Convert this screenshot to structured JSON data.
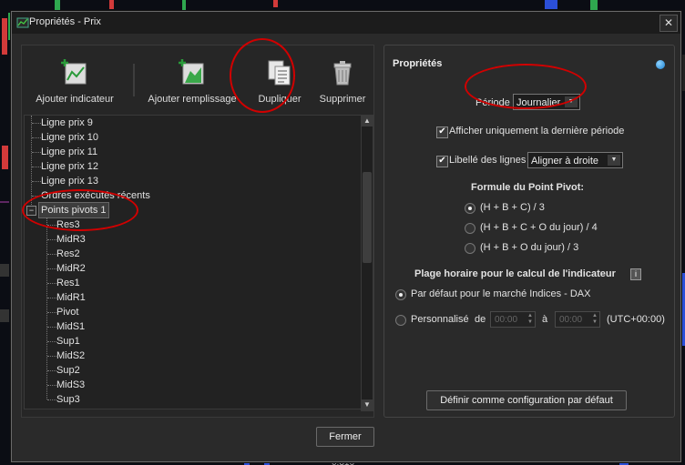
{
  "window": {
    "title": "Propriétés - Prix",
    "close_glyph": "✕"
  },
  "toolbar": {
    "add_indicator": "Ajouter indicateur",
    "add_fill": "Ajouter remplissage",
    "duplicate": "Dupliquer",
    "delete": "Supprimer"
  },
  "tree": {
    "items": [
      "Ligne prix 9",
      "Ligne prix 10",
      "Ligne prix 11",
      "Ligne prix 12",
      "Ligne prix 13",
      "Ordres exécutés récents",
      "Points pivots 1"
    ],
    "expander": "−",
    "children": [
      "Res3",
      "MidR3",
      "Res2",
      "MidR2",
      "Res1",
      "MidR1",
      "Pivot",
      "MidS1",
      "Sup1",
      "MidS2",
      "Sup2",
      "MidS3",
      "Sup3"
    ]
  },
  "properties": {
    "title": "Propriétés",
    "period_label": "Période",
    "period_value": "Journalier",
    "show_last_period_label": "Afficher uniquement la dernière période",
    "show_last_period_checked": true,
    "line_labels_label": "Libellé des lignes",
    "line_labels_checked": true,
    "line_labels_value": "Aligner à droite",
    "pivot_formula_title": "Formule du Point Pivot:",
    "formula_options": [
      "(H + B + C) / 3",
      "(H + B + C + O du jour) / 4",
      "(H + B + O du jour) / 3"
    ],
    "formula_selected": 0,
    "time_range_title": "Plage horaire pour le calcul de l'indicateur",
    "time_default_label": "Par défaut pour le marché Indices - DAX",
    "time_custom_label": "Personnalisé",
    "time_from_label": "de",
    "time_from_value": "00:00",
    "time_to_label": "à",
    "time_to_value": "00:00",
    "timezone": "(UTC+00:00)",
    "set_default_button": "Définir comme configuration par défaut"
  },
  "footer": {
    "close_button": "Fermer"
  },
  "background": {
    "partial_value": "0.316"
  },
  "colors": {
    "annotation_red": "#d10000",
    "dialog_bg": "#2a2a2a",
    "accent_blue": "#1a7fd0"
  }
}
